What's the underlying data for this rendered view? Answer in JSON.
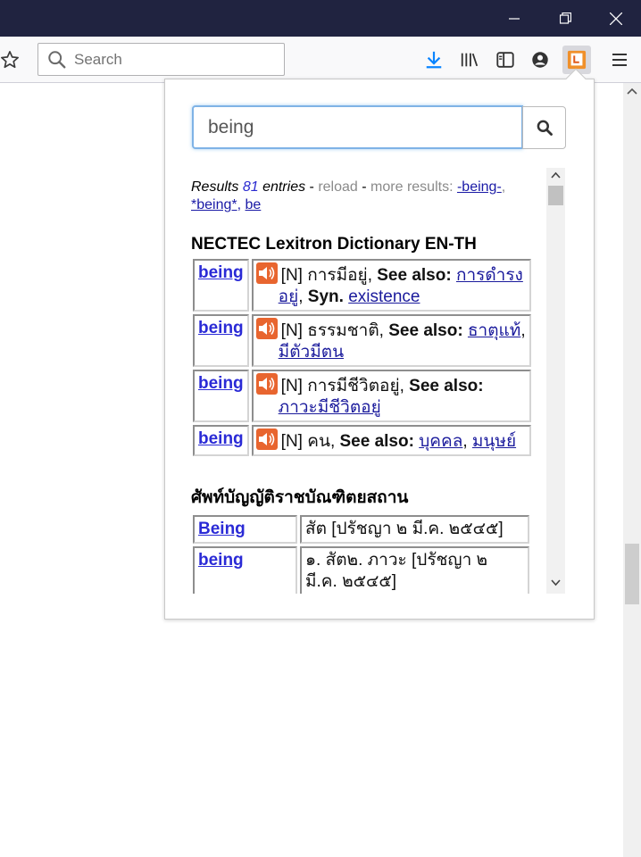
{
  "window": {
    "controls": [
      "minimize-icon",
      "restore-icon",
      "close-icon"
    ]
  },
  "toolbar": {
    "search_placeholder": "Search",
    "icons": [
      "star-icon",
      "download-icon",
      "library-icon",
      "sidebar-icon",
      "account-icon",
      "dictionary-extension-icon",
      "hamburger-menu-icon"
    ]
  },
  "popup": {
    "query": "being",
    "summary": {
      "prefix": "Results",
      "count": "81",
      "entries_word": "entries",
      "dash1": "-",
      "reload": "reload",
      "dash2": "-",
      "more_results": "more results:",
      "links": [
        "-being-",
        "*being*",
        "be"
      ]
    },
    "dictionaries": [
      {
        "name": "NECTEC Lexitron Dictionary EN-TH",
        "entries": [
          {
            "word": "being",
            "pos": "[N]",
            "thai": "การมีอยู่",
            "see_also_label": "See also:",
            "see_also": [
              "การดำรงอยู่"
            ],
            "syn_label": "Syn.",
            "syn": [
              "existence"
            ]
          },
          {
            "word": "being",
            "pos": "[N]",
            "thai": "ธรรมชาติ",
            "see_also_label": "See also:",
            "see_also": [
              "ธาตุแท้",
              "มีตัวมีตน"
            ]
          },
          {
            "word": "being",
            "pos": "[N]",
            "thai": "การมีชีวิตอยู่",
            "see_also_label": "See also:",
            "see_also": [
              "ภาวะมีชีวิตอยู่"
            ]
          },
          {
            "word": "being",
            "pos": "[N]",
            "thai": "คน",
            "see_also_label": "See also:",
            "see_also": [
              "บุคคล",
              "มนุษย์"
            ]
          }
        ]
      },
      {
        "name": "ศัพท์บัญญัติราชบัณฑิตยสถาน",
        "entries": [
          {
            "word": "Being",
            "definition": "สัต [ปรัชญา ๒ มี.ค. ๒๕๔๕]"
          },
          {
            "word": "being",
            "definition": "๑. สัต๒. ภาวะ [ปรัชญา ๒ มี.ค. ๒๕๔๕]"
          }
        ]
      }
    ]
  },
  "colors": {
    "titlebar": "#202340",
    "toolbar": "#f9f9fa",
    "link": "#2a2ad6",
    "speaker": "#e8652f",
    "input_focus": "#7fb3e6"
  }
}
